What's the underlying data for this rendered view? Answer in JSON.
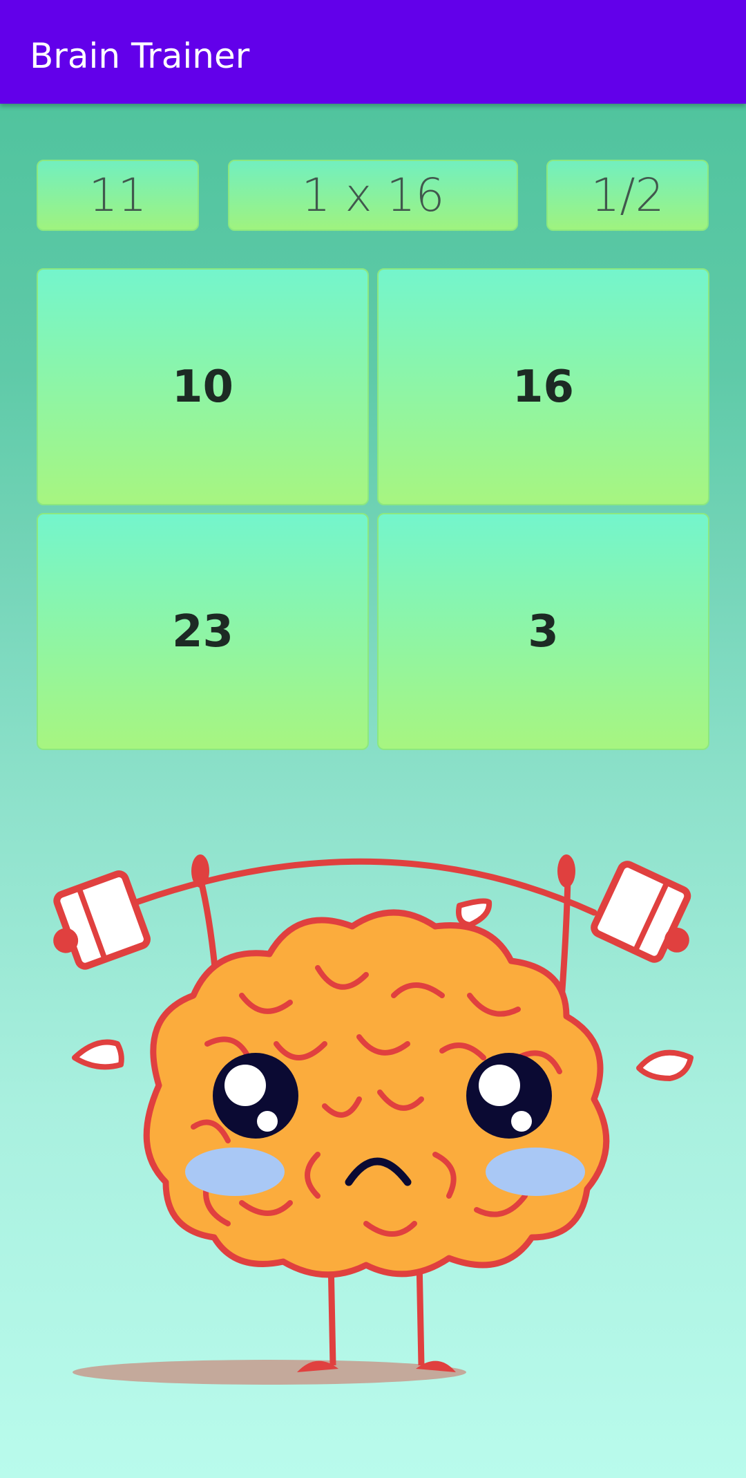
{
  "app_bar": {
    "title": "Brain Trainer"
  },
  "status": {
    "timer": "11",
    "question": "1 x 16",
    "score": "1/2"
  },
  "answers": [
    "10",
    "16",
    "23",
    "3"
  ],
  "colors": {
    "app_bar": "#6200ea",
    "button_top": "#74f5cc",
    "button_bottom": "#a7f580",
    "brain": "#fbac3d",
    "outline": "#e0403f"
  },
  "illustration": {
    "icon": "brain-lifting-barbell-icon"
  }
}
